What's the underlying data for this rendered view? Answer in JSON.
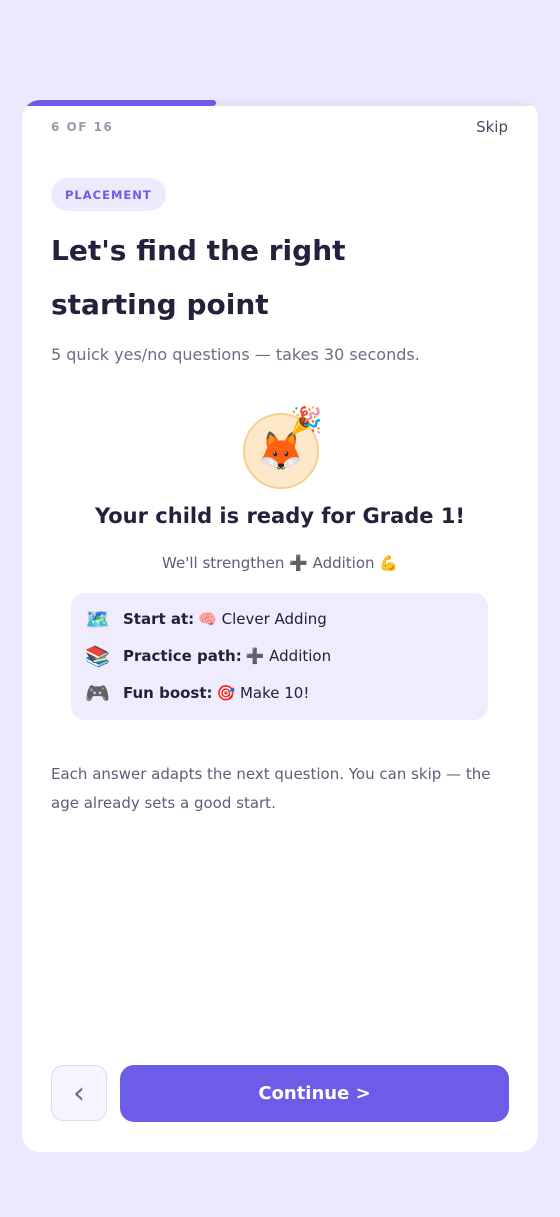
{
  "progress": {
    "step_text": "6 OF 16",
    "fraction": 0.375
  },
  "header": {
    "skip_label": "Skip"
  },
  "badge": "PLACEMENT",
  "title": "Let's find the right starting point",
  "subtitle": "5 quick yes/no questions — takes 30 seconds.",
  "result": {
    "avatar_emoji": "🦊",
    "confetti_emoji": "🎉",
    "headline": "Your child is ready for Grade 1!",
    "strengthen": "We'll strengthen ➕ Addition 💪"
  },
  "plan": [
    {
      "icon": "🗺️",
      "label": "Start at:",
      "value": "🧠 Clever Adding"
    },
    {
      "icon": "📚",
      "label": "Practice path:",
      "value": "➕ Addition"
    },
    {
      "icon": "🎮",
      "label": "Fun boost:",
      "value": "🎯 Make 10!"
    }
  ],
  "footnote": "Each answer adapts the next question. You can skip — the age already sets a good start.",
  "nav": {
    "back_icon": "‹",
    "continue_label": "Continue >"
  },
  "colors": {
    "accent": "#6c5ce7",
    "background": "#ece8fd"
  }
}
